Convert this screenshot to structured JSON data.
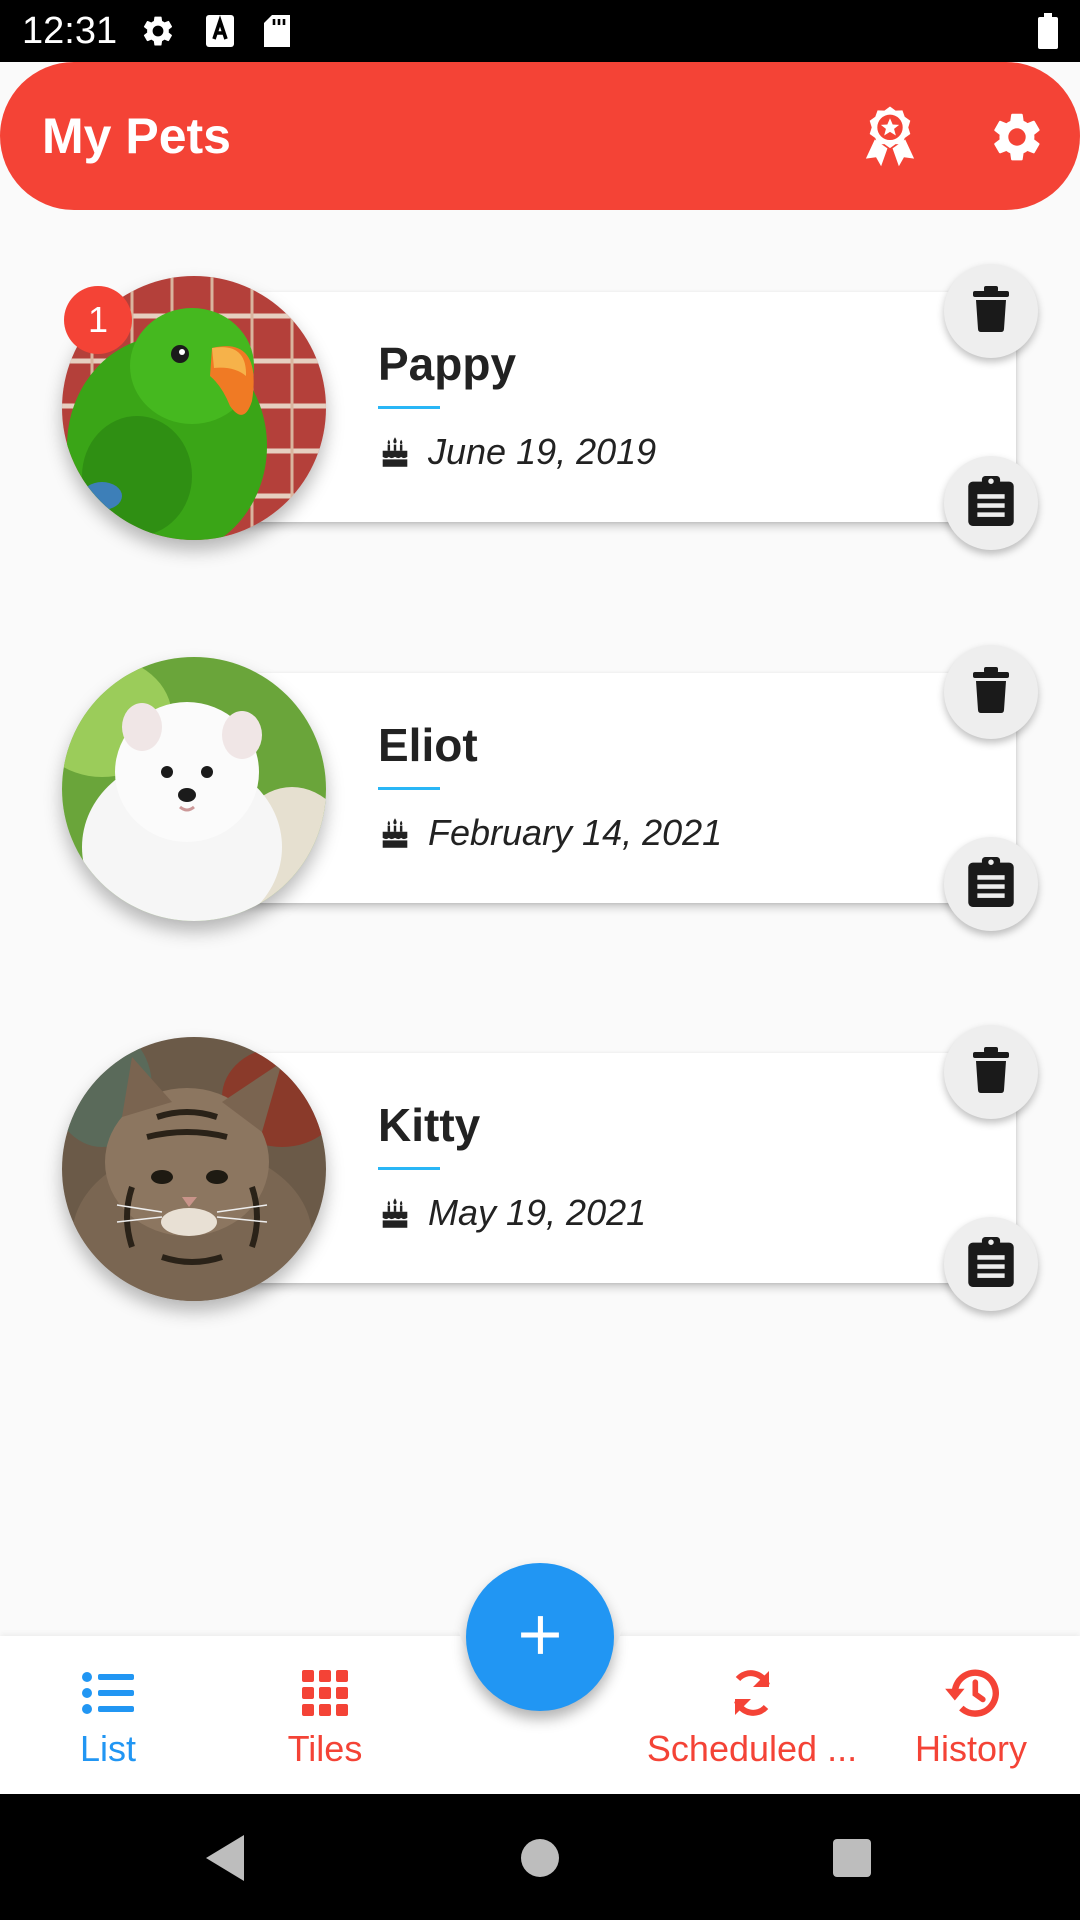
{
  "status_bar": {
    "time": "12:31",
    "icons": [
      "gear-icon",
      "font-a-icon",
      "sd-card-icon",
      "battery-icon"
    ]
  },
  "app_bar": {
    "title": "My Pets",
    "actions": [
      "award-icon",
      "gear-icon"
    ],
    "color": "#f44336"
  },
  "pets": [
    {
      "name": "Pappy",
      "birthday": "June 19, 2019",
      "badge": "1",
      "photo": "green-parrot"
    },
    {
      "name": "Eliot",
      "birthday": "February 14, 2021",
      "photo": "white-pomeranian-puppy"
    },
    {
      "name": "Kitty",
      "birthday": "May 19, 2021",
      "photo": "tabby-kitten"
    }
  ],
  "card_actions": [
    "trash-icon",
    "clipboard-icon"
  ],
  "bottom_nav": {
    "items": [
      {
        "label": "List",
        "icon": "list-icon",
        "color": "#2196f3",
        "active": true
      },
      {
        "label": "Tiles",
        "icon": "grid-icon",
        "color": "#f44336"
      },
      {
        "label": "Scheduled ...",
        "icon": "sync-icon",
        "color": "#f44336"
      },
      {
        "label": "History",
        "icon": "history-icon",
        "color": "#f44336"
      }
    ],
    "fab_icon": "plus-icon",
    "fab_color": "#2196f3"
  },
  "system_nav": [
    "back-icon",
    "home-icon",
    "recents-icon"
  ]
}
